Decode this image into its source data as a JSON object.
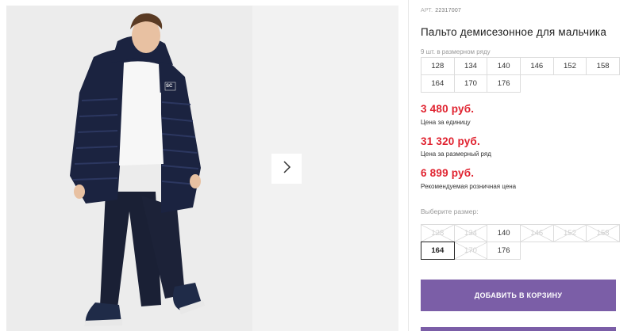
{
  "product": {
    "article_label": "АРТ.",
    "article_number": "22317007",
    "title": "Пальто демисезонное для мальчика",
    "pack_note": "9 шт. в размерном ряду",
    "pack_sizes": [
      "128",
      "134",
      "140",
      "146",
      "152",
      "158",
      "164",
      "170",
      "176"
    ],
    "prices": [
      {
        "value": "3 480 руб.",
        "note": "Цена за единицу"
      },
      {
        "value": "31 320 руб.",
        "note": "Цена за размерный ряд"
      },
      {
        "value": "6 899 руб.",
        "note": "Рекомендуемая розничная цена"
      }
    ],
    "choose_size_label": "Выберите размер:",
    "size_options": [
      {
        "label": "128",
        "state": "disabled"
      },
      {
        "label": "134",
        "state": "disabled"
      },
      {
        "label": "140",
        "state": "available"
      },
      {
        "label": "146",
        "state": "disabled"
      },
      {
        "label": "152",
        "state": "disabled"
      },
      {
        "label": "158",
        "state": "disabled"
      },
      {
        "label": "164",
        "state": "selected"
      },
      {
        "label": "170",
        "state": "disabled"
      },
      {
        "label": "176",
        "state": "available"
      }
    ],
    "add_to_cart_label": "ДОБАВИТЬ В КОРЗИНУ"
  },
  "gallery": {
    "next_icon": "chevron-right-icon",
    "badge_text": "SC"
  },
  "colors": {
    "price": "#e0222f",
    "button": "#7b5ea7",
    "jacket": "#1b2340"
  }
}
